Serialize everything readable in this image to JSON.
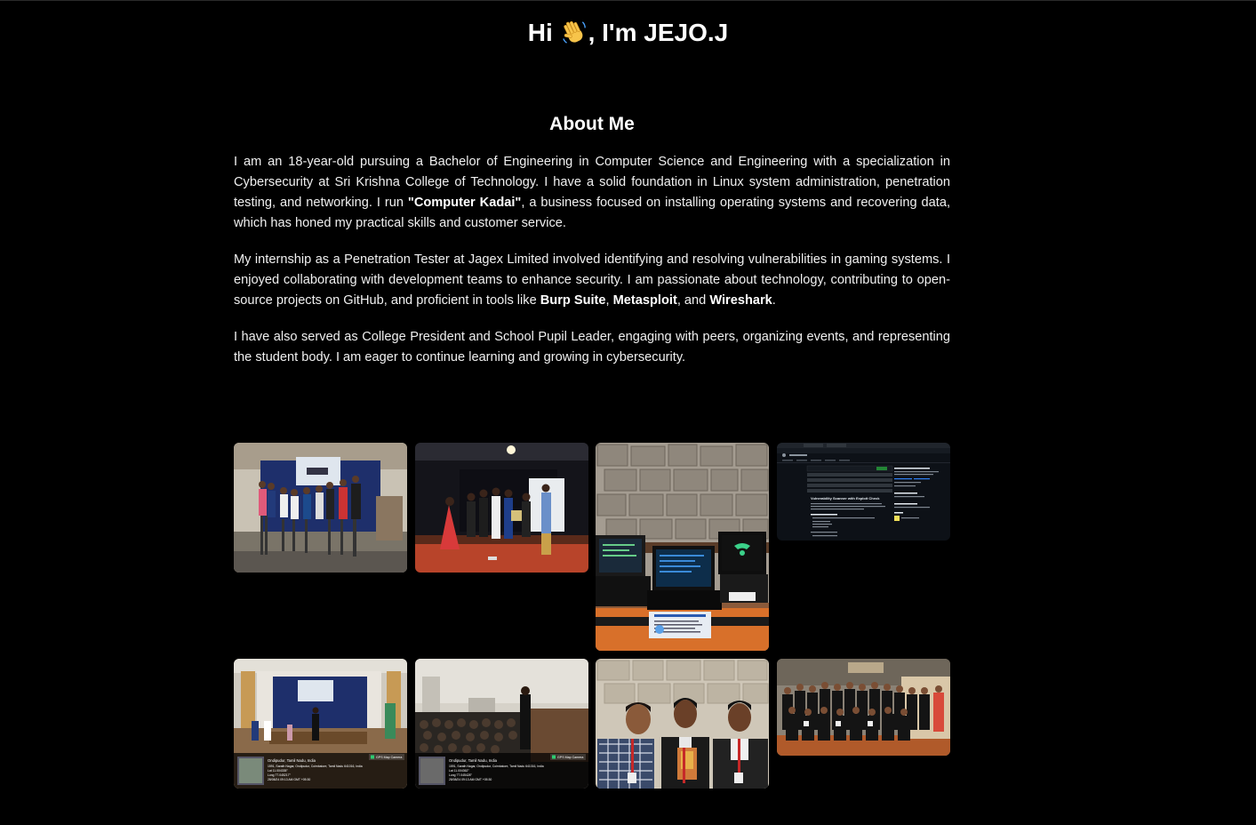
{
  "hero": {
    "greeting": "Hi",
    "wave_icon": "waving-hand-icon",
    "name_text": ", I'm JEJO.J"
  },
  "about": {
    "heading": "About Me",
    "p1": {
      "a": "I am an 18-year-old pursuing a Bachelor of Engineering in Computer Science and Engineering with a specialization in Cybersecurity at Sri Krishna College of Technology. I have a solid foundation in Linux system administration, penetration testing, and networking. I run ",
      "business": "\"Computer Kadai\"",
      "b": ", a business focused on installing operating systems and recovering data, which has honed my practical skills and customer service."
    },
    "p2": {
      "a": "My internship as a Penetration Tester at Jagex Limited involved identifying and resolving vulnerabilities in gaming systems. I enjoyed collaborating with development teams to enhance security. I am passionate about technology, contributing to open-source projects on GitHub, and proficient in tools like ",
      "tool1": "Burp Suite",
      "sep1": ", ",
      "tool2": "Metasploit",
      "sep2": ", and ",
      "tool3": "Wireshark",
      "end": "."
    },
    "p3": "I have also served as College President and School Pupil Leader, engaging with peers, organizing events, and representing the student body. I am eager to continue learning and growing in cybersecurity."
  },
  "gallery": {
    "photo5_caption": {
      "line1": "Ondipudur, Tamil Nadu, India",
      "line2": "1591, Sarath Nagar, Ondipudur, Coimbatore, Tamil Nadu 641016, India",
      "line3": "Lat 11.004335°",
      "line4": "Long 77.045217°",
      "line5": "28/08/24 09:13 AM GMT +05:30",
      "badge": "GPS Map Camera"
    },
    "photo6_caption": {
      "line1": "Ondipudur, Tamil Nadu, India",
      "line2": "1591, Sarath Nagar, Ondipudur, Coimbatore, Tamil Nadu 641016, India",
      "line3": "Lat 11.004362°",
      "line4": "Long 77.045428°",
      "line5": "28/08/24 09:13 AM GMT +05:30",
      "badge": "GPS Map Camera"
    },
    "screenshot_title": "Vulnerability Scanner with Exploit Check"
  },
  "colors": {
    "background": "#000000",
    "text": "#ffffff",
    "body_text": "#f0f0f0"
  }
}
